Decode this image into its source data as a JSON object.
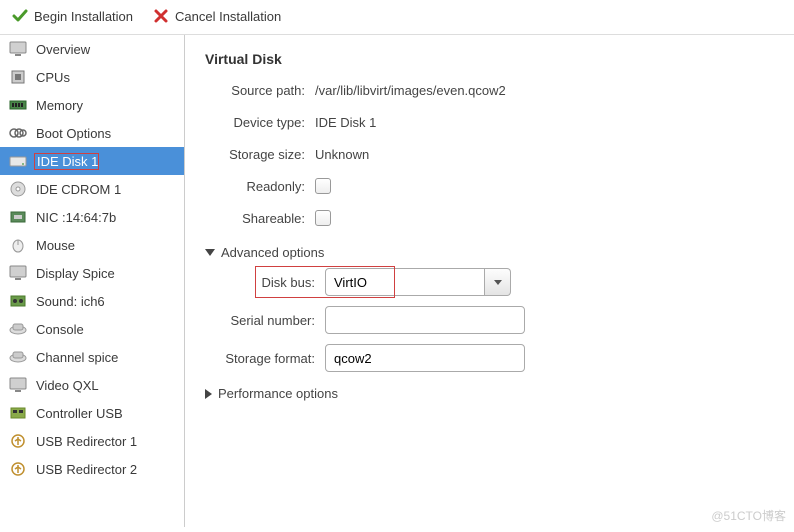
{
  "toolbar": {
    "begin": "Begin Installation",
    "cancel": "Cancel Installation"
  },
  "sidebar": {
    "items": [
      {
        "label": "Overview",
        "icon": "monitor"
      },
      {
        "label": "CPUs",
        "icon": "cpu"
      },
      {
        "label": "Memory",
        "icon": "memory"
      },
      {
        "label": "Boot Options",
        "icon": "boot"
      },
      {
        "label": "IDE Disk 1",
        "icon": "disk",
        "selected": true,
        "highlighted": true
      },
      {
        "label": "IDE CDROM 1",
        "icon": "cdrom"
      },
      {
        "label": "NIC :14:64:7b",
        "icon": "nic"
      },
      {
        "label": "Mouse",
        "icon": "mouse"
      },
      {
        "label": "Display Spice",
        "icon": "display"
      },
      {
        "label": "Sound: ich6",
        "icon": "sound"
      },
      {
        "label": "Console",
        "icon": "console"
      },
      {
        "label": "Channel spice",
        "icon": "channel"
      },
      {
        "label": "Video QXL",
        "icon": "video"
      },
      {
        "label": "Controller USB",
        "icon": "usb-ctrl"
      },
      {
        "label": "USB Redirector 1",
        "icon": "usb"
      },
      {
        "label": "USB Redirector 2",
        "icon": "usb"
      }
    ]
  },
  "details": {
    "title": "Virtual Disk",
    "source_path_label": "Source path:",
    "source_path": "/var/lib/libvirt/images/even.qcow2",
    "device_type_label": "Device type:",
    "device_type": "IDE Disk 1",
    "storage_size_label": "Storage size:",
    "storage_size": "Unknown",
    "readonly_label": "Readonly:",
    "shareable_label": "Shareable:",
    "advanced_label": "Advanced options",
    "disk_bus_label": "Disk bus:",
    "disk_bus_value": "VirtIO",
    "serial_label": "Serial number:",
    "serial_value": "",
    "storage_format_label": "Storage format:",
    "storage_format_value": "qcow2",
    "performance_label": "Performance options"
  },
  "watermark": "@51CTO博客"
}
